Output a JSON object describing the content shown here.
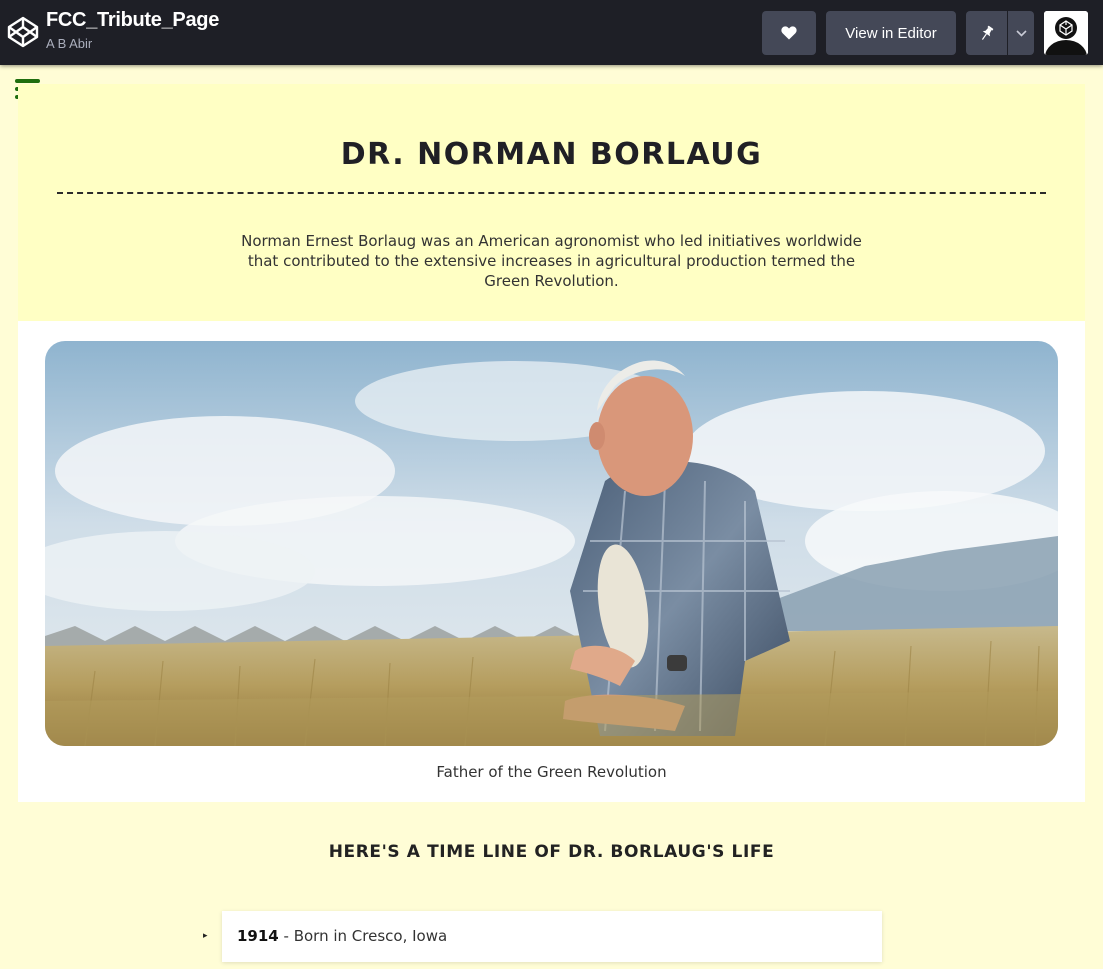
{
  "topbar": {
    "title": "FCC_Tribute_Page",
    "author": "A B Abir",
    "editor_label": "View in Editor",
    "icons": [
      "codepen-logo-icon",
      "heart-icon",
      "pin-icon",
      "chevron-down-icon"
    ],
    "background": "#1e1f26",
    "button_color": "#444857"
  },
  "page": {
    "title": "DR. NORMAN BORLAUG",
    "intro": "Norman Ernest Borlaug was an American agronomist who led initiatives worldwide that contributed to the extensive increases in agricultural production termed the Green Revolution.",
    "caption": "Father of the Green Revolution",
    "timeline_heading": "HERE'S A TIME LINE OF DR. BORLAUG'S LIFE",
    "timeline": [
      {
        "year": "1914",
        "text": " - Born in Cresco, Iowa"
      }
    ],
    "menu_icon": "hamburger-menu-icon",
    "colors": {
      "page_bg": "#fffdd6",
      "header_bg": "#ffffc4",
      "menu_green": "#1f6e0e"
    }
  }
}
